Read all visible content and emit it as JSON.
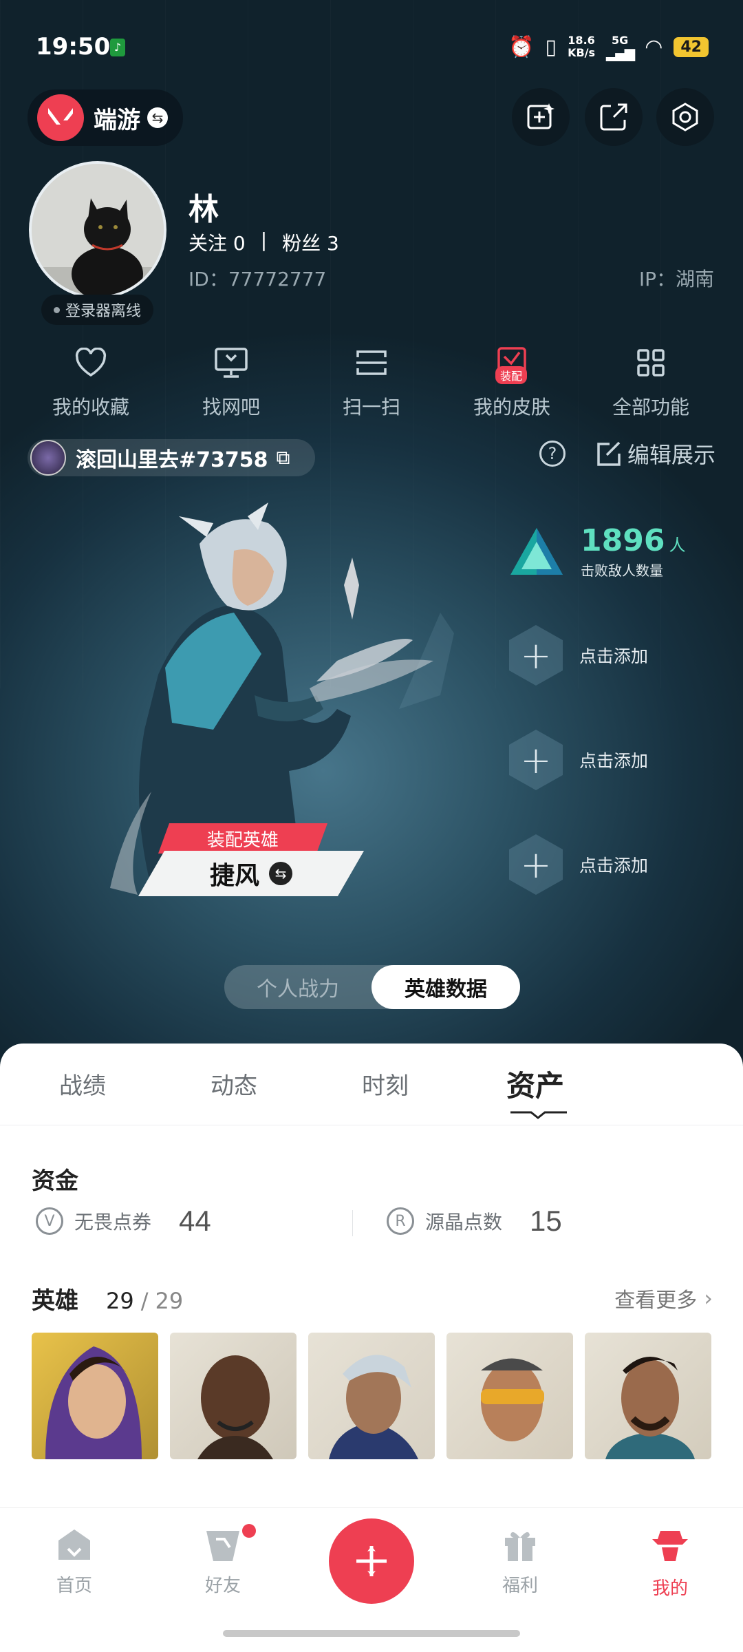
{
  "status": {
    "time": "19:50",
    "net_speed": "18.6",
    "net_unit": "KB/s",
    "net_type": "5G",
    "battery": "42"
  },
  "header": {
    "brand": "端游"
  },
  "profile": {
    "name": "林",
    "follow": "关注 0",
    "divider": "|",
    "fans": "粉丝 3",
    "id": "ID：77772777",
    "ip": "IP：湖南",
    "online": "登录器离线"
  },
  "quick_actions": [
    {
      "label": "我的收藏",
      "icon": "heart-icon"
    },
    {
      "label": "找网吧",
      "icon": "monitor-icon"
    },
    {
      "label": "扫一扫",
      "icon": "scan-icon"
    },
    {
      "label": "我的皮肤",
      "icon": "skin-icon",
      "badge": "装配"
    },
    {
      "label": "全部功能",
      "icon": "grid-icon"
    }
  ],
  "game_account": {
    "name": "滚回山里去#73758",
    "edit": "编辑展示"
  },
  "showcase": {
    "stat_value": "1896",
    "stat_unit": "人",
    "stat_label": "击败敌人数量",
    "add_label": "点击添加",
    "equip_badge": "装配英雄",
    "agent_name": "捷风"
  },
  "toggle": {
    "left": "个人战力",
    "right": "英雄数据"
  },
  "tabs": [
    {
      "label": "战绩"
    },
    {
      "label": "动态"
    },
    {
      "label": "时刻"
    },
    {
      "label": "资产",
      "active": true
    }
  ],
  "assets": {
    "title": "资金",
    "vp_label": "无畏点券",
    "vp_value": "44",
    "rp_label": "源晶点数",
    "rp_value": "15"
  },
  "heroes": {
    "title": "英雄",
    "owned": "29",
    "sep": "/",
    "total": "29",
    "more": "查看更多"
  },
  "bottom_nav": [
    {
      "label": "首页",
      "icon": "home-icon"
    },
    {
      "label": "好友",
      "icon": "friends-icon"
    },
    {
      "label": "",
      "icon": "plus-icon"
    },
    {
      "label": "福利",
      "icon": "gift-icon"
    },
    {
      "label": "我的",
      "icon": "profile-icon",
      "active": true
    }
  ],
  "colors": {
    "accent": "#ee3f52",
    "stat": "#5fe0c0"
  }
}
